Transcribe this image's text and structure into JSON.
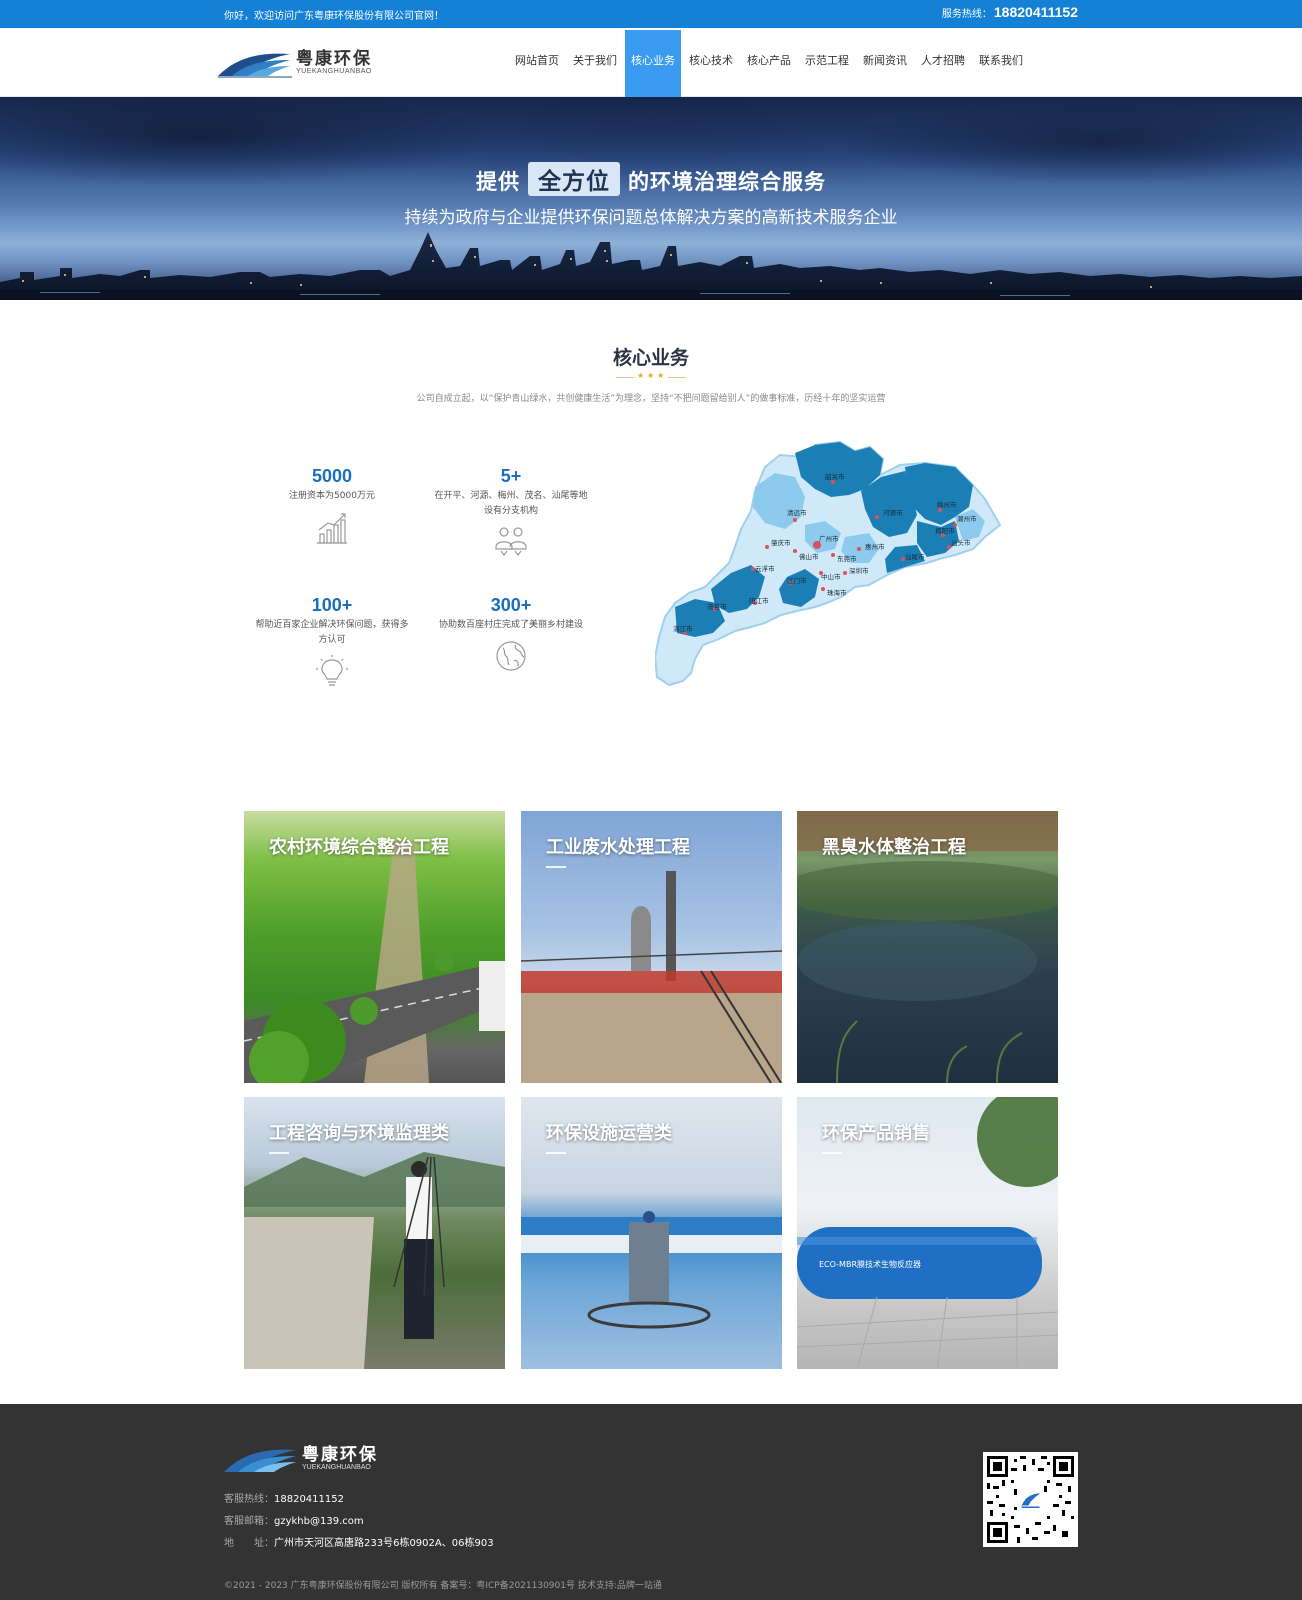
{
  "topbar": {
    "welcome": "你好，欢迎访问广东粤康环保股份有限公司官网！",
    "hotline_label": "服务热线：",
    "hotline_number": "18820411152"
  },
  "header": {
    "logo_cn": "粤康环保",
    "logo_en": "YUEKANGHUANBAO",
    "nav": [
      {
        "label": "网站首页"
      },
      {
        "label": "关于我们"
      },
      {
        "label": "核心业务",
        "active": true
      },
      {
        "label": "核心技术"
      },
      {
        "label": "核心产品"
      },
      {
        "label": "示范工程"
      },
      {
        "label": "新闻资讯"
      },
      {
        "label": "人才招聘"
      },
      {
        "label": "联系我们"
      }
    ]
  },
  "banner": {
    "line1_pre": "提供",
    "line1_highlight": "全方位",
    "line1_post": "的环境治理综合服务",
    "line2": "持续为政府与企业提供环保问题总体解决方案的高新技术服务企业"
  },
  "section": {
    "title": "核心业务",
    "description": "公司自成立起，以“保护青山绿水，共创健康生活”为理念，坚持“不把问题留给别人”的做事标准，历经十年的坚实运营"
  },
  "stats": [
    {
      "number": "5000",
      "text": "注册资本为5000万元",
      "icon": "bar-chart-icon"
    },
    {
      "number": "5+",
      "text": "在开平、河源、梅州、茂名、汕尾等地设有分支机构",
      "icon": "people-icon"
    },
    {
      "number": "100+",
      "text": "帮助近百家企业解决环保问题，获得多方认可",
      "icon": "lightbulb-icon"
    },
    {
      "number": "300+",
      "text": "协助数百座村庄完成了美丽乡村建设",
      "icon": "globe-icon"
    }
  ],
  "map": {
    "cities": [
      "韶关市",
      "清远市",
      "河源市",
      "梅州市",
      "潮州市",
      "揭阳市",
      "汕头市",
      "广州市",
      "肇庆市",
      "佛山市",
      "东莞市",
      "惠州市",
      "汕尾市",
      "云浮市",
      "中山市",
      "深圳市",
      "江门市",
      "珠海市",
      "阳江市",
      "茂名市",
      "湛江市"
    ]
  },
  "cards": [
    {
      "title": "农村环境综合整治工程"
    },
    {
      "title": "工业废水处理工程"
    },
    {
      "title": "黑臭水体整治工程"
    },
    {
      "title": "工程咨询与环境监理类"
    },
    {
      "title": "环保设施运营类"
    },
    {
      "title": "环保产品销售",
      "tank_text": "ECO-MBR膜技术生物反应器"
    }
  ],
  "footer": {
    "logo_cn": "粤康环保",
    "logo_en": "YUEKANGHUANBAO",
    "phone_label": "客服热线：",
    "phone": "18820411152",
    "email_label": "客服邮箱：",
    "email": "gzykhb@139.com",
    "address_label": "地　　址：",
    "address": "广州市天河区高唐路233号6栋0902A、06栋903",
    "copyright": "©2021 - 2023 广东粤康环保股份有限公司   版权所有    备案号：粤ICP备2021130901号    技术支持:品牌一站通"
  },
  "colors": {
    "topbar": "#1581d6",
    "nav_active": "#3b9bf0",
    "stat_number": "#1a6fbd",
    "footer": "#333333"
  }
}
